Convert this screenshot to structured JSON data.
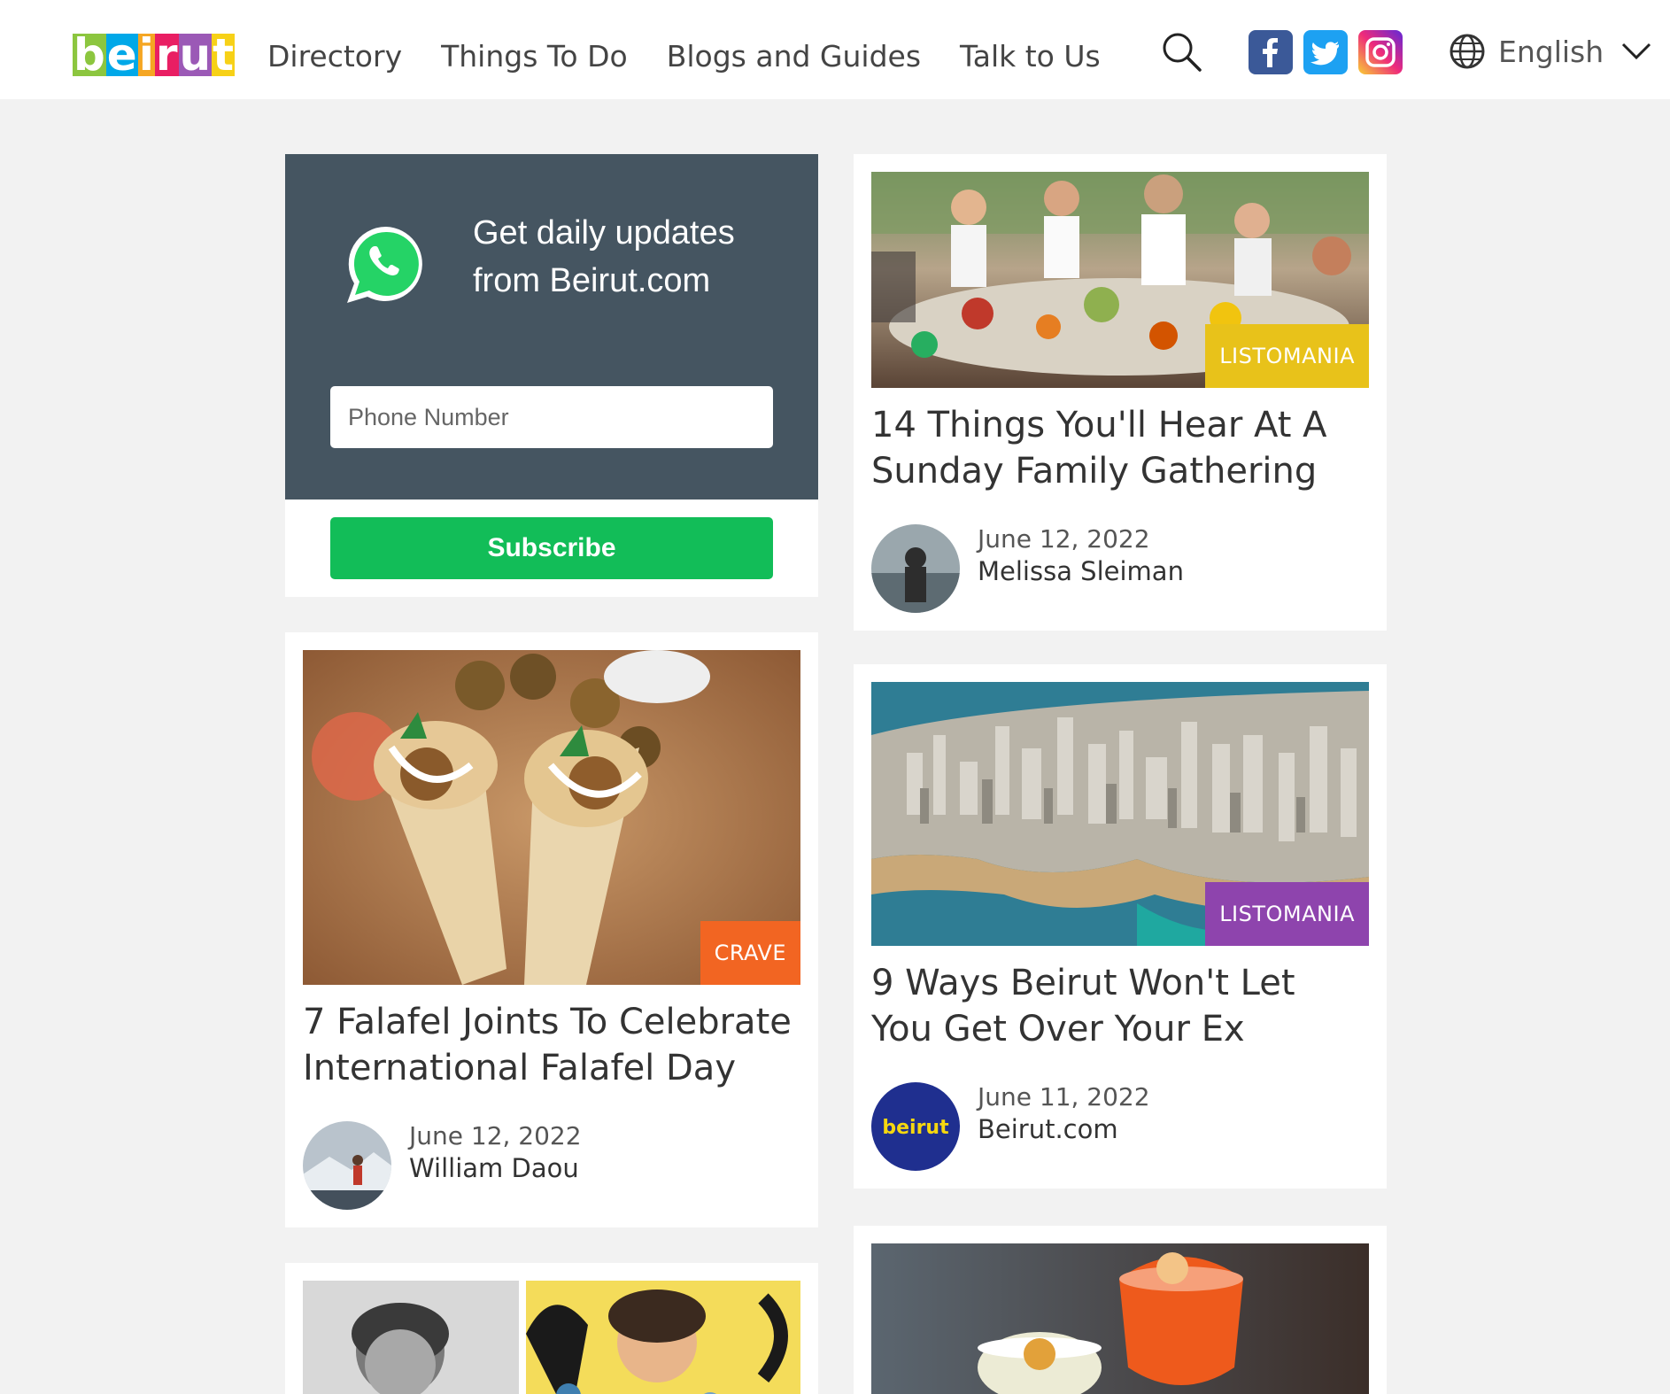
{
  "header": {
    "logo_letters": [
      "b",
      "e",
      "i",
      "r",
      "u",
      "t"
    ],
    "logo_colors": [
      "#8cc63f",
      "#00a8e8",
      "#f5a623",
      "#e91e63",
      "#9b59b6",
      "#f7d117"
    ],
    "nav": [
      "Directory",
      "Things To Do",
      "Blogs and Guides",
      "Talk to Us"
    ],
    "language": "English",
    "icons": [
      "search-icon",
      "facebook-icon",
      "twitter-icon",
      "instagram-icon",
      "globe-icon",
      "chevron-down-icon"
    ]
  },
  "whatsapp": {
    "text": "Get daily updates from Beirut.com",
    "placeholder": "Phone Number",
    "button": "Subscribe"
  },
  "articles": [
    {
      "category": "LISTOMANIA",
      "category_color": "#e8c21a",
      "title": "14 Things You'll Hear At A Sunday Family Gathering",
      "date": "June 12, 2022",
      "author": "Melissa Sleiman"
    },
    {
      "category": "CRAVE",
      "category_color": "#f26522",
      "title": "7 Falafel Joints To Celebrate International Falafel Day",
      "date": "June 12, 2022",
      "author": "William Daou"
    },
    {
      "category": "LISTOMANIA",
      "category_color": "#8e44ad",
      "title": "9 Ways Beirut Won't Let You Get Over Your Ex",
      "date": "June 11, 2022",
      "author": "Beirut.com"
    }
  ],
  "avatar_logo_text": "beirut"
}
